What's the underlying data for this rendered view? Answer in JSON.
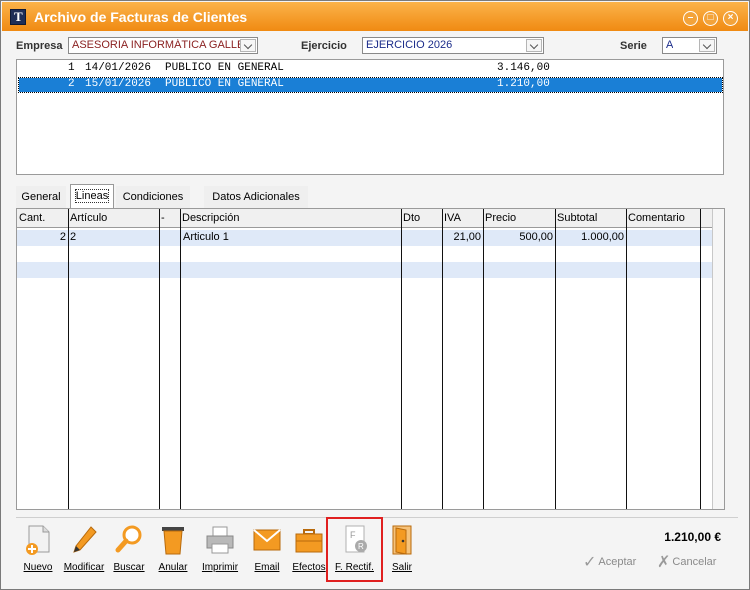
{
  "window": {
    "title": "Archivo de Facturas de Clientes"
  },
  "filters": {
    "empresa_label": "Empresa",
    "empresa_value": "ASESORIA INFORMÁTICA GALLEG",
    "ejercicio_label": "Ejercicio",
    "ejercicio_value": "EJERCICIO 2026",
    "serie_label": "Serie",
    "serie_value": "A"
  },
  "invoices": [
    {
      "num": "1",
      "date": "14/01/2026",
      "client": "PUBLICO EN GENERAL",
      "amount": "3.146,00",
      "selected": false
    },
    {
      "num": "2",
      "date": "15/01/2026",
      "client": "PUBLICO EN GENERAL",
      "amount": "1.210,00",
      "selected": true
    }
  ],
  "tabs": [
    {
      "label": "General",
      "active": false
    },
    {
      "label": "Lineas",
      "active": true
    },
    {
      "label": "Condiciones",
      "active": false
    },
    {
      "label": "Datos Adicionales",
      "active": false
    }
  ],
  "lines_grid": {
    "headers": [
      "Cant.",
      "Artículo",
      "-",
      "Descripción",
      "Dto",
      "IVA",
      "Precio",
      "Subtotal",
      "Comentario"
    ],
    "rows": [
      {
        "cant": "2",
        "articulo": "2",
        "dash": "",
        "descripcion": "Articulo 1",
        "dto": "",
        "iva": "21,00",
        "precio": "500,00",
        "subtotal": "1.000,00",
        "comentario": ""
      }
    ]
  },
  "toolbar": {
    "items": [
      {
        "label": "Nuevo",
        "icon": "new-document-icon"
      },
      {
        "label": "Modificar",
        "icon": "pencil-icon"
      },
      {
        "label": "Buscar",
        "icon": "magnifier-icon"
      },
      {
        "label": "Anular",
        "icon": "trash-bin-icon"
      },
      {
        "label": "Imprimir",
        "icon": "printer-icon"
      },
      {
        "label": "Email",
        "icon": "envelope-icon"
      },
      {
        "label": "Efectos",
        "icon": "briefcase-icon"
      },
      {
        "label": "F. Rectif.",
        "icon": "rectified-invoice-icon"
      },
      {
        "label": "Salir",
        "icon": "exit-door-icon"
      }
    ]
  },
  "footer": {
    "total": "1.210,00 €",
    "accept_label": "Aceptar",
    "cancel_label": "Cancelar"
  },
  "colors": {
    "title_bar": "#f39a22",
    "selection": "#1a7fd6",
    "alt_row": "#dfe9f8",
    "highlight": "#e02020"
  }
}
